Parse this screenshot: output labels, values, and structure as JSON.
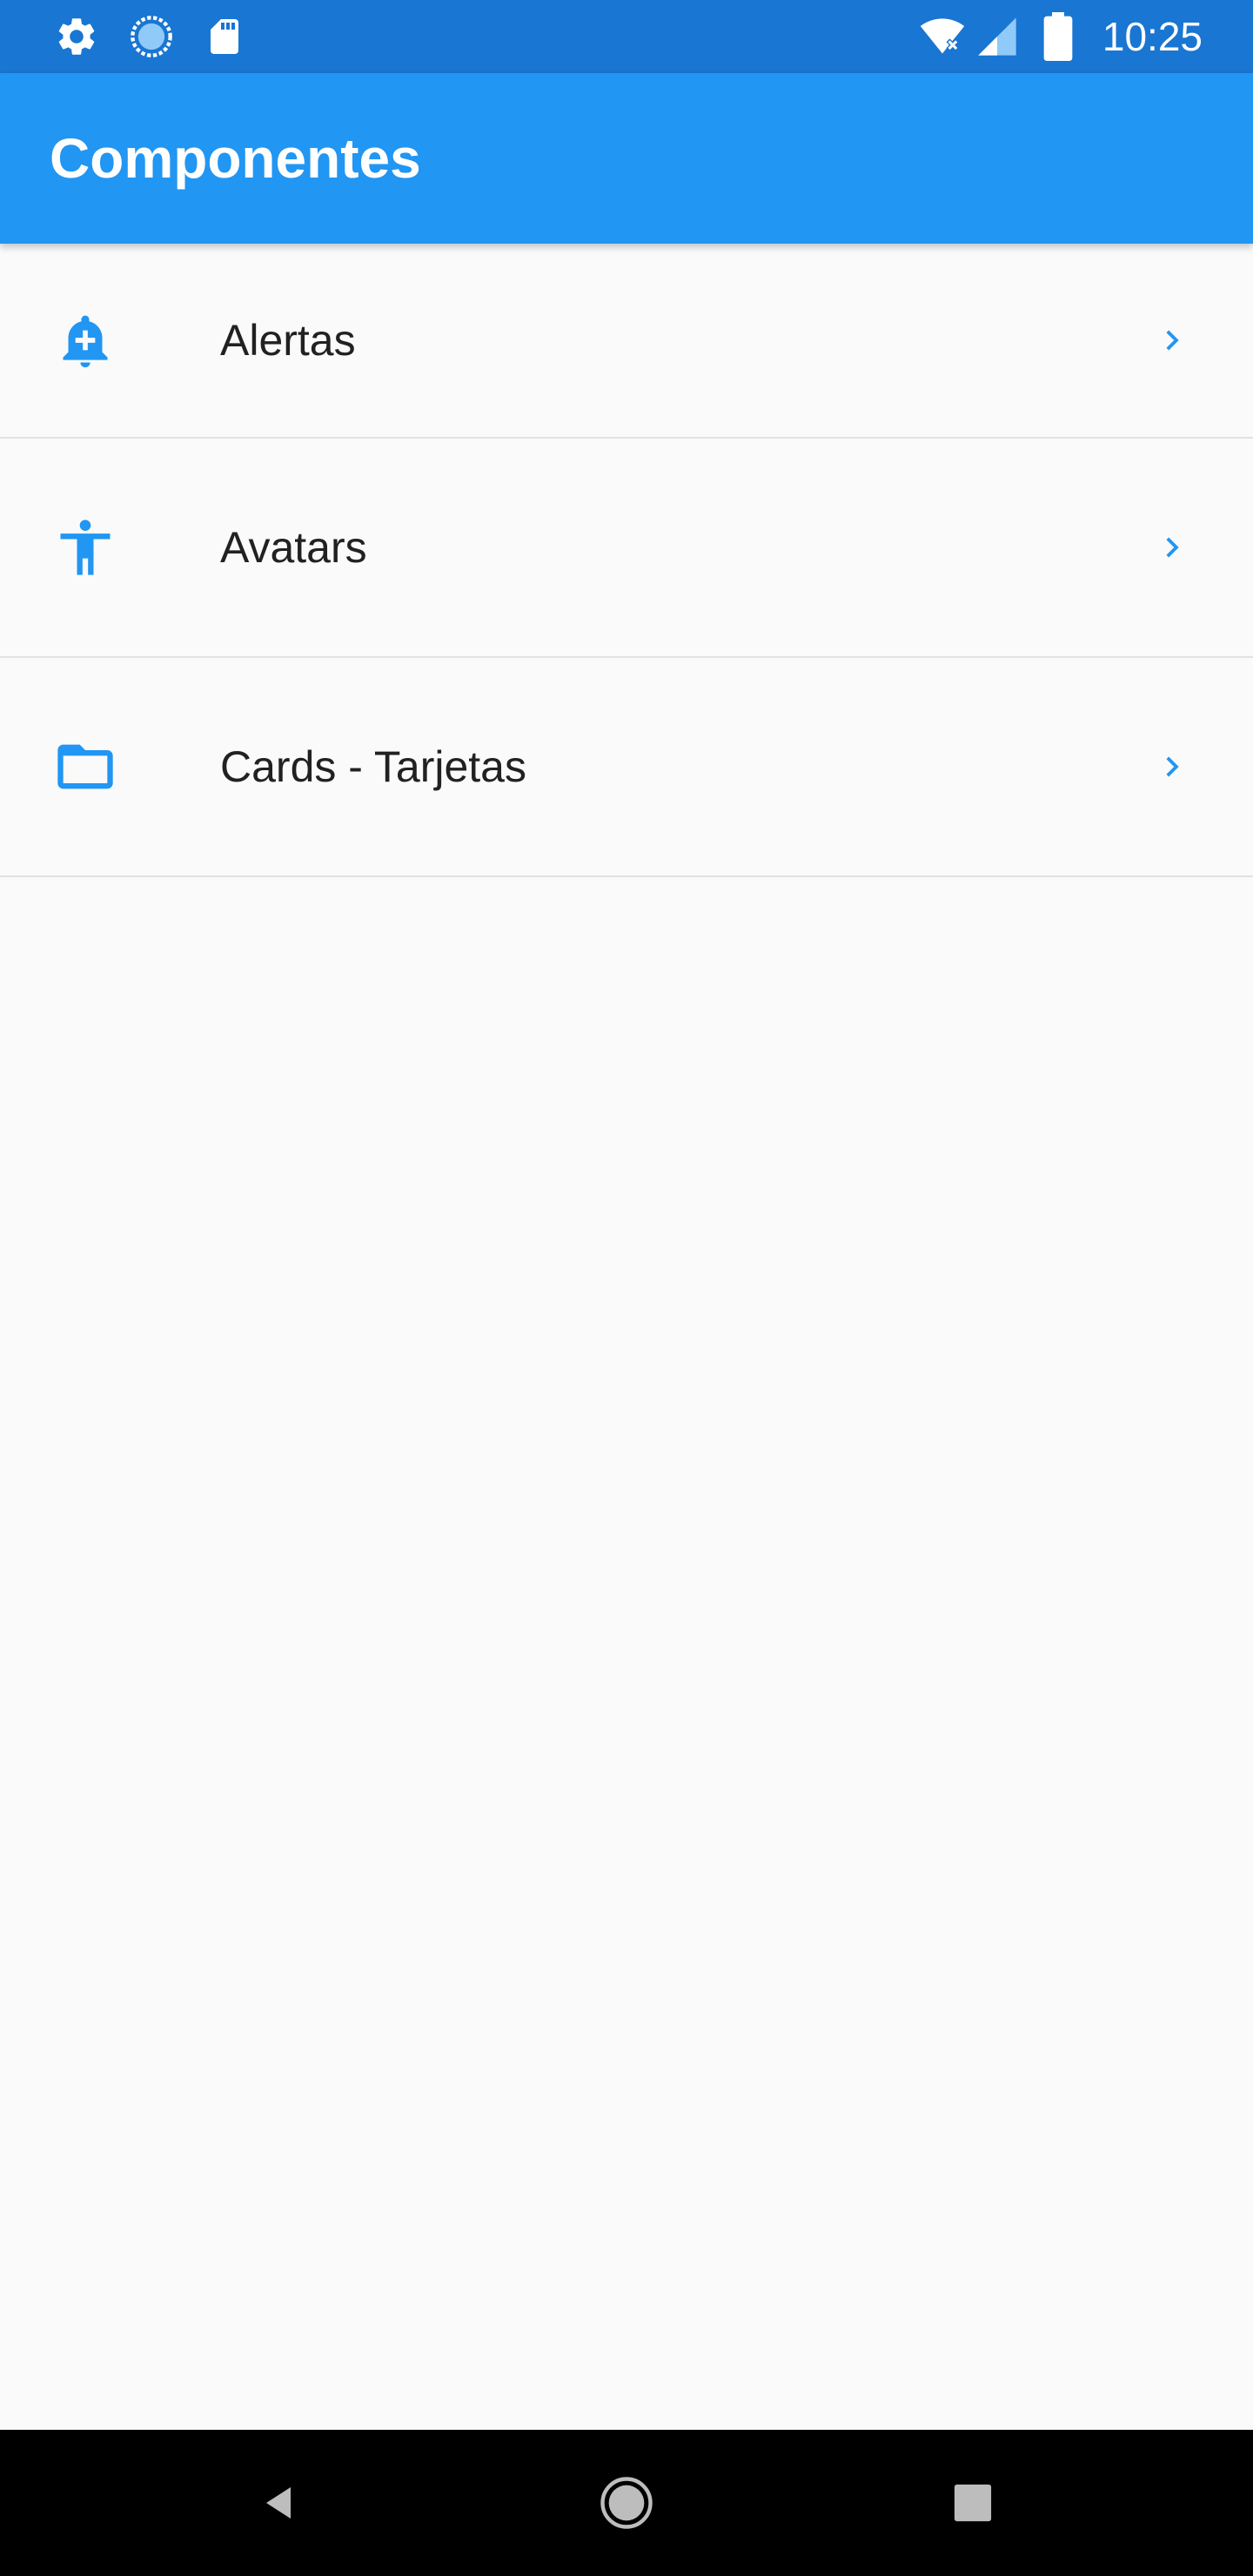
{
  "status_bar": {
    "time": "10:25",
    "left_icons": [
      "gear-icon",
      "sync-icon",
      "sd-card-icon"
    ],
    "right_icons": [
      "wifi-icon",
      "cellular-signal-icon",
      "battery-icon"
    ]
  },
  "app_bar": {
    "title": "Componentes",
    "color": "#2196f3"
  },
  "list": {
    "items": [
      {
        "label": "Alertas",
        "icon": "add-alert-icon",
        "trailing": "chevron-right-icon"
      },
      {
        "label": "Avatars",
        "icon": "accessibility-icon",
        "trailing": "chevron-right-icon"
      },
      {
        "label": "Cards - Tarjetas",
        "icon": "folder-icon",
        "trailing": "chevron-right-icon"
      }
    ]
  },
  "nav_bar": {
    "buttons": [
      "back-icon",
      "home-icon",
      "recents-icon"
    ]
  },
  "colors": {
    "accent": "#2196f3",
    "status_bar": "#1976d2",
    "background": "#fafafa",
    "divider": "#e2e2e2"
  }
}
